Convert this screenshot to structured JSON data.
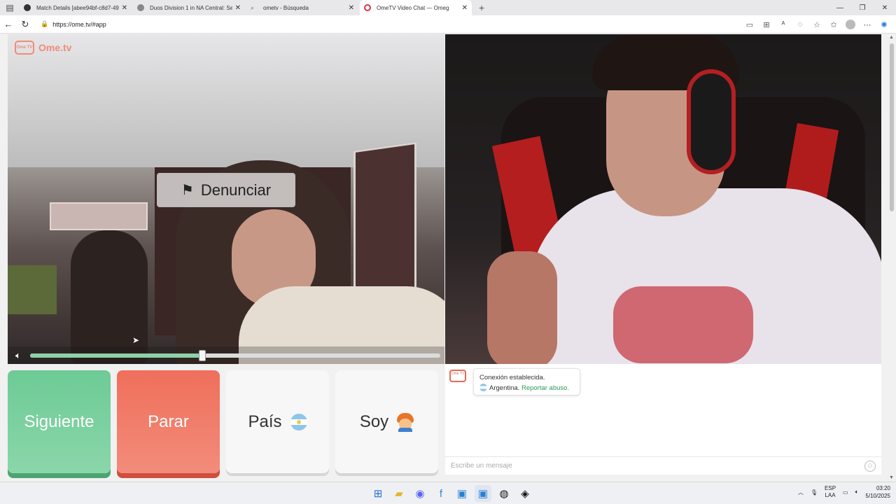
{
  "browser": {
    "tabs": [
      {
        "title": "Match Details [abee94bf-c8d7-49",
        "active": false,
        "icon": "game-icon"
      },
      {
        "title": "Duos Division 1 in NA Central: Se",
        "active": false,
        "icon": "globe-icon"
      },
      {
        "title": "ometv - Búsqueda",
        "active": false,
        "icon": "search-icon"
      },
      {
        "title": "OmeTV Video Chat — Omeg",
        "active": true,
        "icon": "ometv-icon"
      }
    ],
    "new_tab": "+",
    "url": "https://ome.tv/#app"
  },
  "app": {
    "logo_text": "Ome.tv",
    "logo_mark": "Ome TV",
    "report_button": "Denunciar",
    "volume_level": 0.42,
    "buttons": {
      "next": "Siguiente",
      "stop": "Parar",
      "country": "País",
      "gender": "Soy"
    },
    "chat": {
      "status_line": "Conexión establecida.",
      "country_label": "Argentina.",
      "report_link": "Reportar abuso.",
      "input_placeholder": "Escribe un mensaje"
    }
  },
  "taskbar": {
    "lang_top": "ESP",
    "lang_bottom": "LAA",
    "time": "03:20",
    "date": "5/10/2025"
  }
}
